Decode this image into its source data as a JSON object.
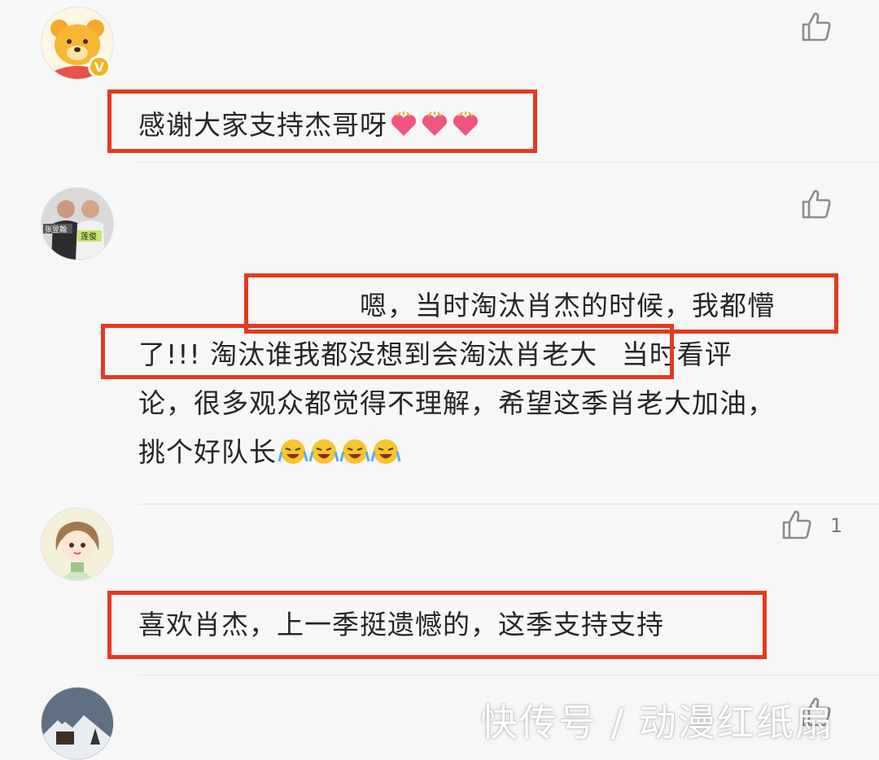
{
  "comments": [
    {
      "avatar": "winnie-pooh-avatar",
      "verified_mark": "V",
      "like_count": "",
      "text": "感谢大家支持杰哥呀",
      "emoji": "heart-emoji"
    },
    {
      "avatar": "two-men-photo-avatar",
      "avatar_labels": [
        "张昱翰",
        "莲俊"
      ],
      "like_count": "",
      "line1": "嗯，当时淘汰肖杰的时候，我都懵",
      "line2": "了!!! 淘汰谁我都没想到会淘汰肖老大",
      "line2_tail": "当时看评",
      "line3": "论，很多观众都觉得不理解，希望这季肖老大加油，",
      "line4": "挑个好队长",
      "emoji": "crying-laugh-emoji"
    },
    {
      "avatar": "cartoon-girl-avatar",
      "like_count": "1",
      "text": "喜欢肖杰，上一季挺遗憾的，这季支持支持"
    },
    {
      "avatar": "snowy-landscape-avatar",
      "like_count": ""
    }
  ],
  "watermark": "快传号 / 动漫红纸扇",
  "colors": {
    "highlight": "#e5391f",
    "text": "#262626",
    "icon": "#8c8c8c"
  }
}
